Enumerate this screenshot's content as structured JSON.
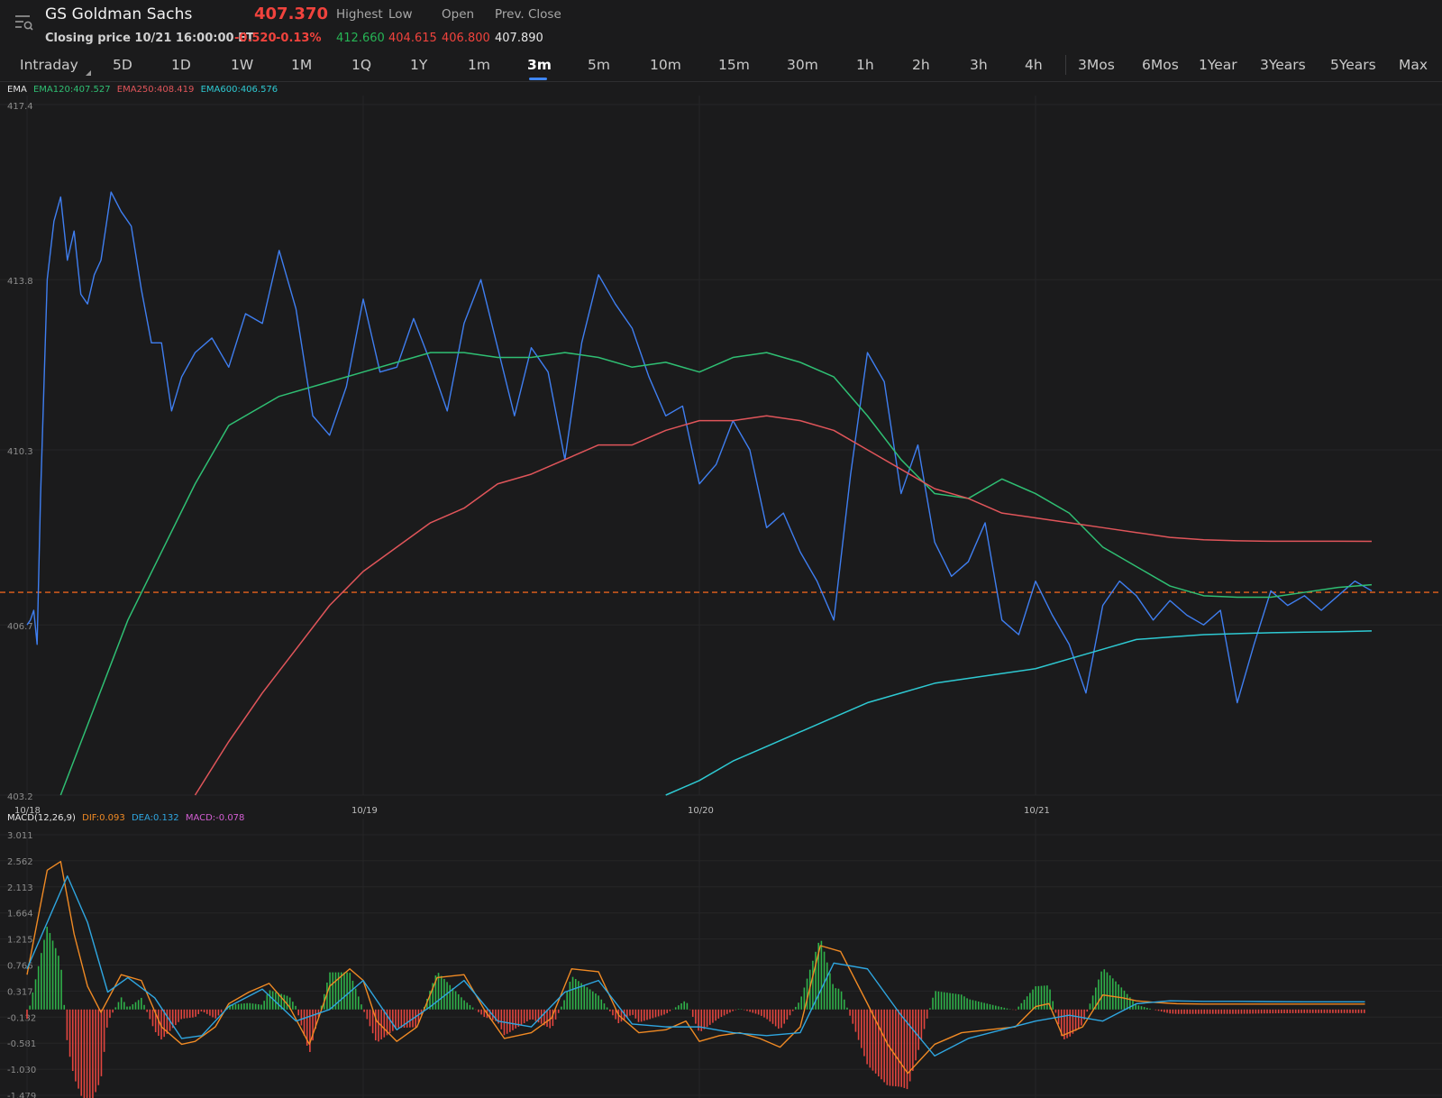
{
  "header": {
    "title": "GS Goldman Sachs",
    "price": "407.370",
    "closing_label": "Closing price 10/21 16:00:00 ET",
    "change": "-0.520",
    "change_pct": "-0.13%",
    "stats": [
      {
        "label": "Highest",
        "value": "412.660",
        "color": "#26b455"
      },
      {
        "label": "Low",
        "value": "404.615",
        "color": "#f0433d"
      },
      {
        "label": "Open",
        "value": "406.800",
        "color": "#f0433d"
      },
      {
        "label": "Prev. Close",
        "value": "407.890",
        "color": "#e6e6e6"
      }
    ]
  },
  "tabs": [
    "Intraday",
    "5D",
    "1D",
    "1W",
    "1M",
    "1Q",
    "1Y",
    "1m",
    "3m",
    "5m",
    "10m",
    "15m",
    "30m",
    "1h",
    "2h",
    "3h",
    "4h",
    "3Mos",
    "6Mos",
    "1Year",
    "3Years",
    "5Years",
    "Max"
  ],
  "active_tab": "3m",
  "ema_legend": {
    "name": "EMA",
    "ema120": "EMA120:407.527",
    "ema250": "EMA250:408.419",
    "ema600": "EMA600:406.576"
  },
  "macd_legend": {
    "name": "MACD(12,26,9)",
    "dif": "DIF:0.093",
    "dea": "DEA:0.132",
    "macd": "MACD:-0.078"
  },
  "colors": {
    "price": "#3f7ef0",
    "ema120": "#2fbf73",
    "ema250": "#e0555a",
    "ema600": "#2ec9d2",
    "dif": "#f08a24",
    "dea": "#2fa6e0",
    "macd": "#d45fd4",
    "pos_bar": "#2fb24a",
    "neg_bar": "#e2453f",
    "ref_line": "#e8621d"
  },
  "chart_data": [
    {
      "type": "line",
      "title": "",
      "x_ticks": [
        "10/18",
        "10/19",
        "10/20",
        "10/21"
      ],
      "y_ticks": [
        "417.4",
        "413.8",
        "410.3",
        "406.7",
        "403.2"
      ],
      "ylim": [
        403.2,
        417.4
      ],
      "reference_line": 407.37,
      "series": [
        {
          "name": "price",
          "x": [
            0,
            0.01,
            0.02,
            0.03,
            0.04,
            0.06,
            0.08,
            0.1,
            0.12,
            0.14,
            0.16,
            0.18,
            0.2,
            0.22,
            0.25,
            0.28,
            0.31,
            0.34,
            0.37,
            0.4,
            0.43,
            0.46,
            0.5,
            0.55,
            0.6,
            0.65,
            0.7,
            0.75,
            0.8,
            0.85,
            0.9,
            0.95,
            1.0,
            1.05,
            1.1,
            1.15,
            1.2,
            1.25,
            1.3,
            1.35,
            1.4,
            1.45,
            1.5,
            1.55,
            1.6,
            1.65,
            1.7,
            1.75,
            1.8,
            1.85,
            1.9,
            1.95,
            2.0,
            2.05,
            2.1,
            2.15,
            2.2,
            2.25,
            2.3,
            2.35,
            2.4,
            2.45,
            2.5,
            2.55,
            2.6,
            2.65,
            2.7,
            2.75,
            2.8,
            2.85,
            2.9,
            2.95,
            3.0,
            3.05,
            3.1,
            3.15,
            3.2,
            3.25,
            3.3,
            3.35,
            3.4,
            3.45,
            3.5,
            3.55,
            3.6,
            3.65,
            3.7,
            3.75,
            3.8,
            3.85,
            3.9,
            3.95,
            4.0
          ],
          "values": [
            406.7,
            406.8,
            407.0,
            406.3,
            409.3,
            413.8,
            415.0,
            415.5,
            414.2,
            414.8,
            413.5,
            413.3,
            413.9,
            414.2,
            415.6,
            415.2,
            414.9,
            413.6,
            412.5,
            412.5,
            411.1,
            411.8,
            412.3,
            412.6,
            412.0,
            413.1,
            412.9,
            414.4,
            413.2,
            411.0,
            410.6,
            411.6,
            413.4,
            411.9,
            412.0,
            413.0,
            412.1,
            411.1,
            412.9,
            413.8,
            412.4,
            411.0,
            412.4,
            411.9,
            410.1,
            412.5,
            413.9,
            413.3,
            412.8,
            411.8,
            411.0,
            411.2,
            409.6,
            410.0,
            410.9,
            410.3,
            408.7,
            409.0,
            408.2,
            407.6,
            406.8,
            409.8,
            412.3,
            411.7,
            409.4,
            410.4,
            408.4,
            407.7,
            408.0,
            408.8,
            406.8,
            406.5,
            407.6,
            406.9,
            406.3,
            405.3,
            407.1,
            407.6,
            407.3,
            406.8,
            407.2,
            406.9,
            406.7,
            407.0,
            405.1,
            406.3,
            407.4,
            407.1,
            407.3,
            407.0,
            407.3,
            407.6,
            407.4
          ]
        },
        {
          "name": "EMA120",
          "x": [
            0.1,
            0.2,
            0.3,
            0.4,
            0.5,
            0.6,
            0.75,
            0.9,
            1.0,
            1.1,
            1.2,
            1.3,
            1.4,
            1.5,
            1.6,
            1.7,
            1.8,
            1.9,
            2.0,
            2.1,
            2.2,
            2.3,
            2.4,
            2.5,
            2.6,
            2.7,
            2.8,
            2.9,
            3.0,
            3.1,
            3.2,
            3.3,
            3.4,
            3.5,
            3.6,
            3.7,
            3.8,
            3.9,
            4.0
          ],
          "values": [
            403.2,
            405.0,
            406.8,
            408.2,
            409.6,
            410.8,
            411.4,
            411.7,
            411.9,
            412.1,
            412.3,
            412.3,
            412.2,
            412.2,
            412.3,
            412.2,
            412.0,
            412.1,
            411.9,
            412.2,
            412.3,
            412.1,
            411.8,
            411.0,
            410.1,
            409.4,
            409.3,
            409.7,
            409.4,
            409.0,
            408.3,
            407.9,
            407.5,
            407.3,
            407.27,
            407.27,
            407.37,
            407.47,
            407.527
          ]
        },
        {
          "name": "EMA250",
          "x": [
            0.5,
            0.6,
            0.7,
            0.8,
            0.9,
            1.0,
            1.1,
            1.2,
            1.3,
            1.4,
            1.5,
            1.6,
            1.7,
            1.8,
            1.9,
            2.0,
            2.1,
            2.2,
            2.3,
            2.4,
            2.5,
            2.6,
            2.7,
            2.8,
            2.9,
            3.0,
            3.1,
            3.2,
            3.3,
            3.4,
            3.5,
            3.6,
            3.7,
            3.8,
            3.9,
            4.0
          ],
          "values": [
            403.2,
            404.3,
            405.3,
            406.2,
            407.1,
            407.8,
            408.3,
            408.8,
            409.1,
            409.6,
            409.8,
            410.1,
            410.4,
            410.4,
            410.7,
            410.9,
            410.9,
            411.0,
            410.9,
            410.7,
            410.3,
            409.9,
            409.5,
            409.3,
            409.0,
            408.9,
            408.8,
            408.7,
            408.6,
            408.5,
            408.45,
            408.43,
            408.42,
            408.42,
            408.42,
            408.419
          ]
        },
        {
          "name": "EMA600",
          "x": [
            1.9,
            2.0,
            2.1,
            2.2,
            2.3,
            2.4,
            2.5,
            2.6,
            2.7,
            2.8,
            2.9,
            3.0,
            3.1,
            3.2,
            3.3,
            3.4,
            3.5,
            3.6,
            3.7,
            3.8,
            3.9,
            4.0
          ],
          "values": [
            403.2,
            403.5,
            403.9,
            404.2,
            404.5,
            404.8,
            405.1,
            405.3,
            405.5,
            405.6,
            405.7,
            405.8,
            406.0,
            406.2,
            406.4,
            406.45,
            406.5,
            406.52,
            406.54,
            406.55,
            406.56,
            406.576
          ]
        }
      ]
    },
    {
      "type": "line",
      "title": "",
      "y_ticks": [
        "3.011",
        "2.562",
        "2.113",
        "1.664",
        "1.215",
        "0.766",
        "0.317",
        "-0.132",
        "-0.581",
        "-1.030",
        "-1.479"
      ],
      "ylim": [
        -1.479,
        3.011
      ],
      "series": [
        {
          "name": "DIF",
          "x": [
            0,
            0.03,
            0.06,
            0.1,
            0.14,
            0.18,
            0.22,
            0.28,
            0.34,
            0.4,
            0.46,
            0.5,
            0.56,
            0.6,
            0.66,
            0.72,
            0.78,
            0.84,
            0.9,
            0.96,
            1.0,
            1.04,
            1.1,
            1.16,
            1.22,
            1.3,
            1.36,
            1.42,
            1.5,
            1.56,
            1.62,
            1.7,
            1.76,
            1.82,
            1.9,
            1.96,
            2.0,
            2.06,
            2.12,
            2.18,
            2.24,
            2.3,
            2.36,
            2.42,
            2.5,
            2.56,
            2.62,
            2.7,
            2.78,
            2.86,
            2.94,
            3.0,
            3.04,
            3.08,
            3.14,
            3.2,
            3.26,
            3.3,
            3.36,
            3.42,
            3.5,
            3.56,
            3.62,
            3.68,
            3.74,
            3.8,
            3.86,
            3.92,
            3.98
          ],
          "values": [
            0.6,
            1.5,
            2.4,
            2.55,
            1.3,
            0.4,
            -0.05,
            0.6,
            0.5,
            -0.3,
            -0.6,
            -0.55,
            -0.3,
            0.1,
            0.3,
            0.45,
            0.05,
            -0.6,
            0.4,
            0.7,
            0.5,
            -0.2,
            -0.55,
            -0.3,
            0.55,
            0.6,
            0.0,
            -0.5,
            -0.4,
            -0.15,
            0.7,
            0.65,
            -0.1,
            -0.4,
            -0.35,
            -0.2,
            -0.55,
            -0.45,
            -0.4,
            -0.5,
            -0.65,
            -0.3,
            1.1,
            1.0,
            0.1,
            -0.6,
            -1.1,
            -0.6,
            -0.4,
            -0.35,
            -0.3,
            0.05,
            0.1,
            -0.45,
            -0.3,
            0.25,
            0.2,
            0.15,
            0.12,
            0.1,
            0.093,
            0.093,
            0.093,
            0.093,
            0.093,
            0.093,
            0.093,
            0.093,
            0.093
          ]
        },
        {
          "name": "DEA",
          "x": [
            0,
            0.06,
            0.12,
            0.18,
            0.24,
            0.3,
            0.38,
            0.46,
            0.52,
            0.6,
            0.7,
            0.8,
            0.9,
            1.0,
            1.1,
            1.2,
            1.3,
            1.4,
            1.5,
            1.6,
            1.7,
            1.8,
            1.9,
            2.0,
            2.1,
            2.2,
            2.3,
            2.4,
            2.5,
            2.6,
            2.7,
            2.8,
            2.9,
            3.0,
            3.1,
            3.2,
            3.3,
            3.4,
            3.5,
            3.6,
            3.7,
            3.8,
            3.9,
            3.98
          ],
          "values": [
            0.7,
            1.5,
            2.3,
            1.5,
            0.3,
            0.55,
            0.2,
            -0.5,
            -0.45,
            0.05,
            0.35,
            -0.2,
            0.0,
            0.5,
            -0.35,
            0.05,
            0.5,
            -0.2,
            -0.3,
            0.3,
            0.5,
            -0.25,
            -0.3,
            -0.3,
            -0.4,
            -0.45,
            -0.4,
            0.8,
            0.7,
            -0.1,
            -0.8,
            -0.5,
            -0.35,
            -0.2,
            -0.1,
            -0.2,
            0.1,
            0.15,
            0.14,
            0.14,
            0.135,
            0.132,
            0.132,
            0.132
          ]
        }
      ]
    }
  ]
}
